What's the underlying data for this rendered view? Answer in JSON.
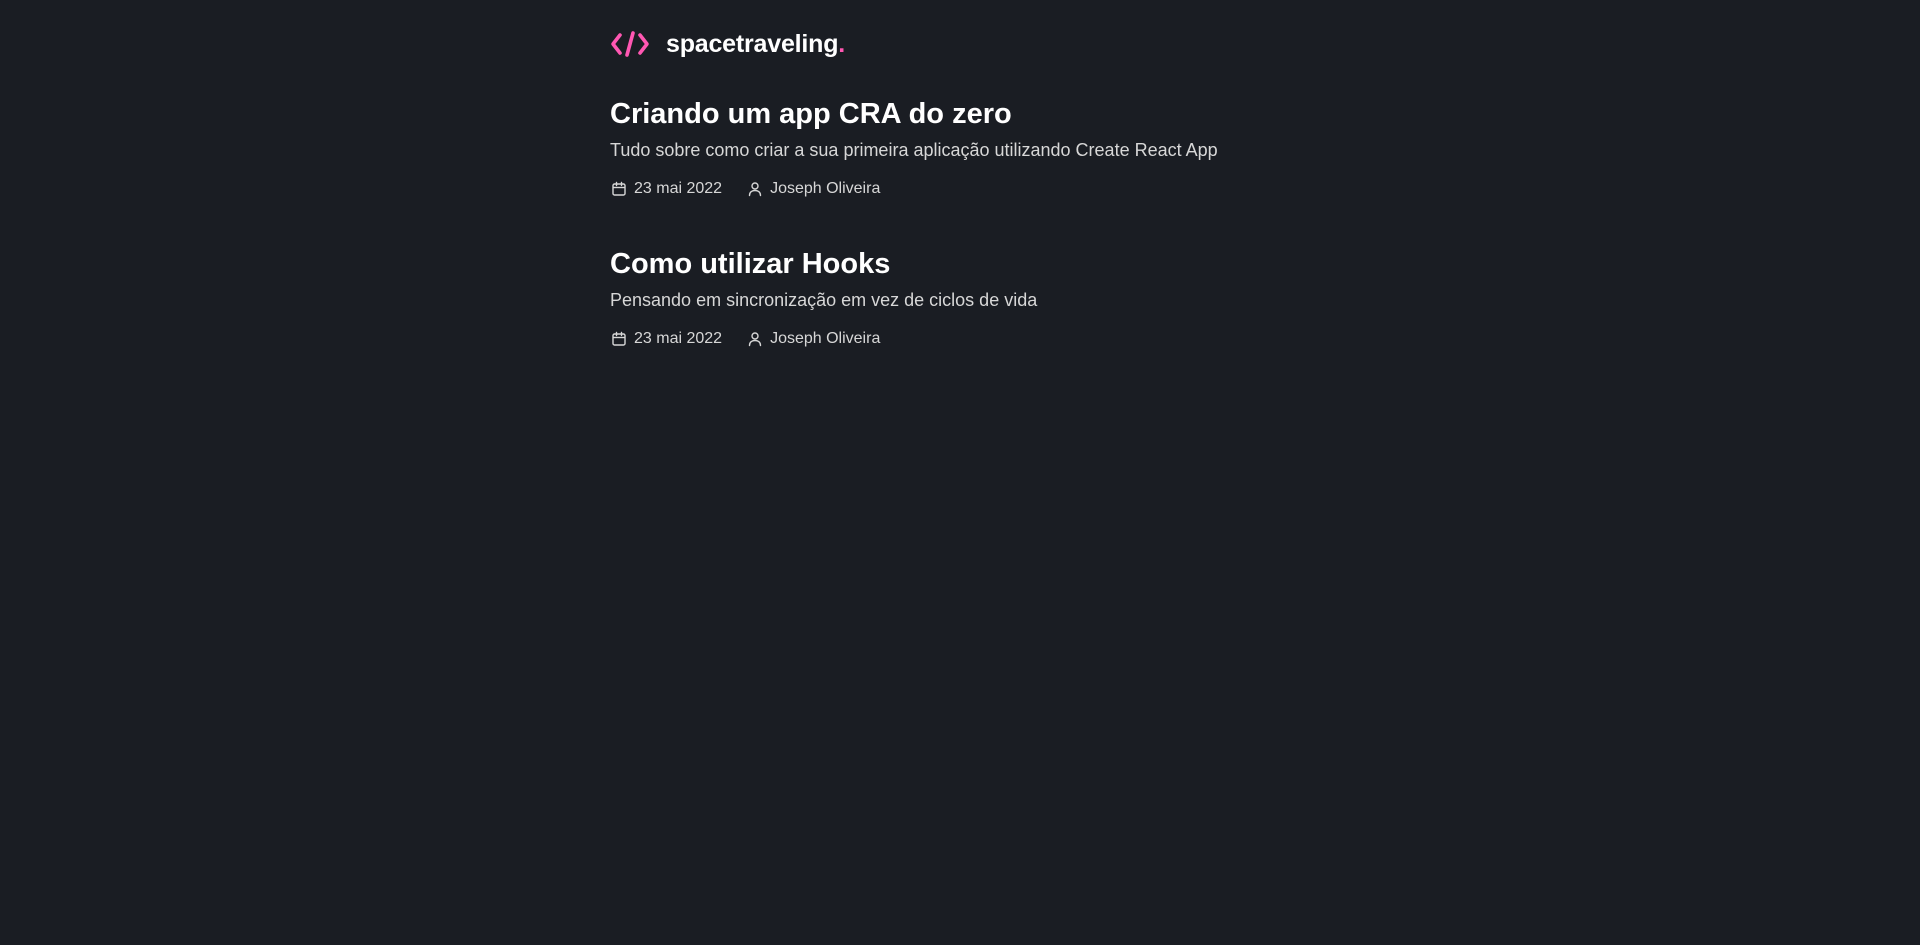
{
  "header": {
    "logo_icon": "code-brackets-icon",
    "logo_text": "spacetraveling",
    "logo_dot": ".",
    "accent_color": "#FF57B2"
  },
  "posts": [
    {
      "title": "Criando um app CRA do zero",
      "subtitle": "Tudo sobre como criar a sua primeira aplicação utilizando Create React App",
      "date": "23 mai 2022",
      "author": "Joseph Oliveira"
    },
    {
      "title": "Como utilizar Hooks",
      "subtitle": "Pensando em sincronização em vez de ciclos de vida",
      "date": "23 mai 2022",
      "author": "Joseph Oliveira"
    }
  ],
  "colors": {
    "background": "#1A1D23",
    "heading": "#FFFFFF",
    "body": "#D7D7D7"
  }
}
